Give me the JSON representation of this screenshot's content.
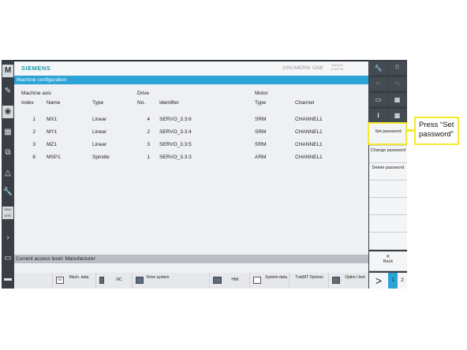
{
  "header": {
    "brand": "SIEMENS",
    "product": "SINUMERIK ONE",
    "date": "09/01/21",
    "time": "12:42 PM"
  },
  "window_title": "Machine configuration",
  "table": {
    "group_headers": {
      "machine_axis": "Machine axis",
      "drive": "Drive",
      "motor": "Motor"
    },
    "columns": {
      "index": "Index",
      "name": "Name",
      "type": "Type",
      "no": "No.",
      "identifier": "Identifier",
      "motor_type": "Type",
      "channel": "Channel"
    },
    "rows": [
      {
        "index": "1",
        "name": "MX1",
        "type": "Linear",
        "no": "4",
        "identifier": "SERVO_3.3:6",
        "motor_type": "SRM",
        "channel": "CHANNEL1"
      },
      {
        "index": "2",
        "name": "MY1",
        "type": "Linear",
        "no": "2",
        "identifier": "SERVO_3.3:4",
        "motor_type": "SRM",
        "channel": "CHANNEL1"
      },
      {
        "index": "3",
        "name": "MZ1",
        "type": "Linear",
        "no": "3",
        "identifier": "SERVO_3.3:5",
        "motor_type": "SRM",
        "channel": "CHANNEL1"
      },
      {
        "index": "6",
        "name": "MSP1",
        "type": "Spindle",
        "no": "1",
        "identifier": "SERVO_3.3:3",
        "motor_type": "ARM",
        "channel": "CHANNEL1"
      }
    ]
  },
  "status": "Current access level: Manufacturer",
  "left_toolbar": {
    "top": "M",
    "sinumerik_short": "SINU MTE"
  },
  "bottom_softkeys": {
    "mach_data": "Mach. data",
    "md_icon": "MD",
    "nc": "NC",
    "drive_system": "Drive system",
    "hmi": "HMI",
    "system_data": "System data",
    "trakmt_options": "TrakMT Options",
    "optim_test": "Optim./ test",
    "next": ">",
    "page1": "1",
    "page2": "2"
  },
  "right_softkeys": {
    "set_password": "Set password",
    "change_password": "Change password",
    "delete_password": "Delete password",
    "back_symbol": "«",
    "back": "Back"
  },
  "callout": "Press “Set password”",
  "colors": {
    "accent": "#2ba3d6",
    "brand": "#1a9aa6",
    "highlight": "#f1ea2e"
  }
}
